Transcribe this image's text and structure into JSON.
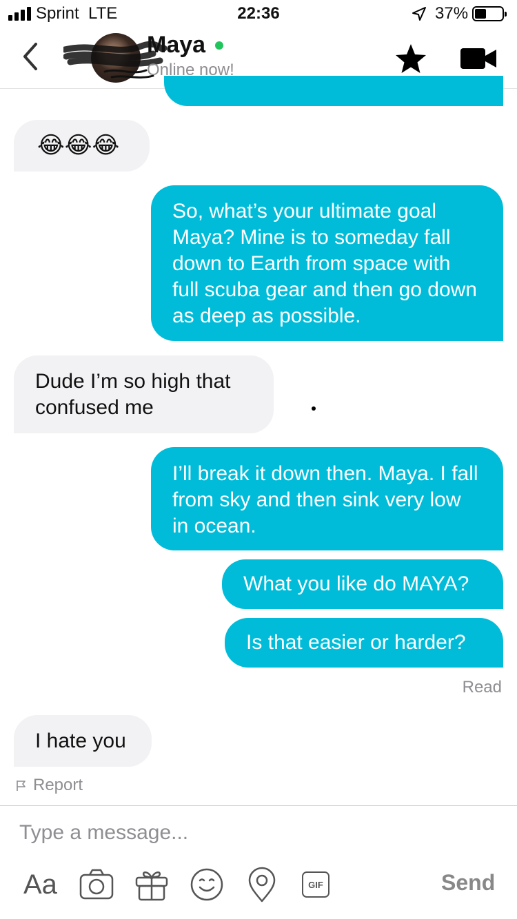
{
  "status_bar": {
    "carrier": "Sprint",
    "network": "LTE",
    "time": "22:36",
    "battery": "37%"
  },
  "header": {
    "name": "Maya",
    "status": "Online now!"
  },
  "messages": [
    {
      "from": "them",
      "text": "😂😂😂"
    },
    {
      "from": "me",
      "text": "So, what’s your ultimate goal Maya? Mine is to someday fall down to Earth from space with full scuba gear and then go down as deep as possible."
    },
    {
      "from": "them",
      "text": "Dude I’m so high that confused me"
    },
    {
      "from": "me",
      "text": "I’ll break it down then. Maya. I fall from sky and then sink very low in ocean."
    },
    {
      "from": "me",
      "text": "What you like do MAYA?"
    },
    {
      "from": "me",
      "text": "Is that easier or harder?"
    },
    {
      "from": "them",
      "text": "I hate you"
    }
  ],
  "read_receipt": "Read",
  "report_label": "Report",
  "composer": {
    "placeholder": "Type a message...",
    "font_toggle": "Aa",
    "gif_label": "GIF",
    "send_label": "Send"
  },
  "colors": {
    "accent": "#00bcd9",
    "incoming": "#f2f2f4",
    "online": "#21c55d"
  },
  "icons": [
    "back-icon",
    "star-icon",
    "video-call-icon",
    "flag-icon",
    "camera-icon",
    "gift-icon",
    "emoji-icon",
    "location-icon",
    "gif-icon"
  ]
}
